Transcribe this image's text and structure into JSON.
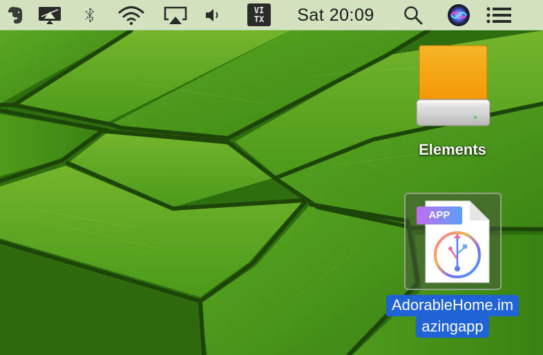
{
  "menubar": {
    "clock": "Sat 20:09",
    "vitx_top": "VI",
    "vitx_bottom": "TX",
    "items": [
      {
        "icon": "evernote-elephant-icon"
      },
      {
        "icon": "display-airplay-icon"
      },
      {
        "icon": "bluetooth-icon"
      },
      {
        "icon": "wifi-icon"
      },
      {
        "icon": "airplay-icon"
      },
      {
        "icon": "volume-icon"
      },
      {
        "icon": "vitx-input-icon"
      },
      {
        "icon": "spotlight-search-icon"
      },
      {
        "icon": "siri-icon"
      },
      {
        "icon": "notification-center-icon"
      }
    ]
  },
  "desktop": {
    "icons": [
      {
        "name": "drive",
        "label": "Elements",
        "icon": "external-drive-icon"
      },
      {
        "name": "app",
        "label_line1": "AdorableHome.im",
        "label_line2": "azingapp",
        "badge": "APP",
        "icon": "app-file-icon",
        "selected": true
      }
    ]
  },
  "colors": {
    "menubar_bg": "#e2ecce",
    "selection_blue": "#1f63d6",
    "wallpaper_green": "#3f8a17",
    "drive_orange": "#f5a30a"
  }
}
